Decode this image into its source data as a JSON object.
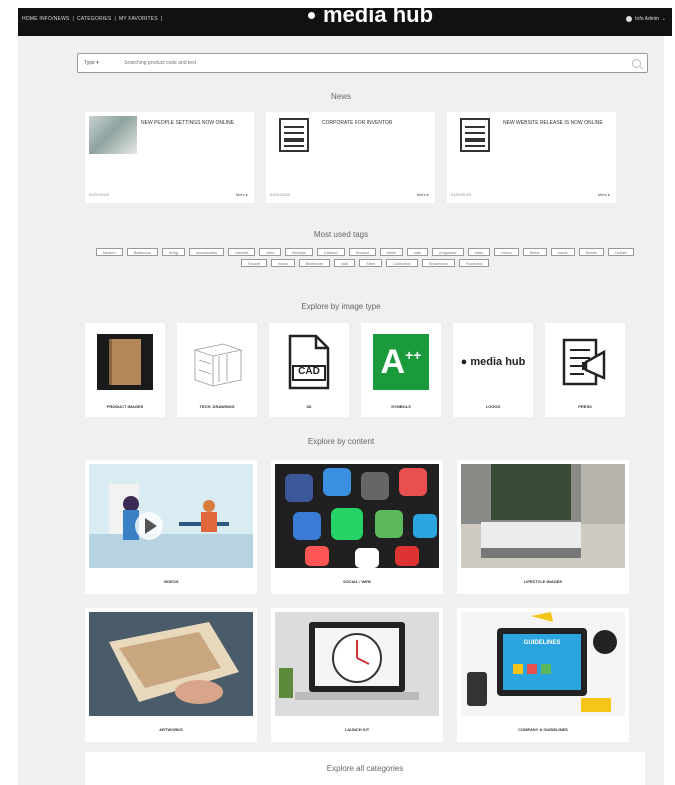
{
  "header": {
    "nav": [
      "HOME INFO/NEWS",
      "|",
      "CATEGORIES",
      "|",
      "MY FAVORITES",
      "|"
    ],
    "brand": "media hub",
    "user": "Info Admin"
  },
  "search": {
    "type_label": "Type ▾",
    "placeholder": "Searching product code and text"
  },
  "sections": {
    "news": "News",
    "tags": "Most used tags",
    "image_type": "Explore by image type",
    "content": "Explore by content",
    "all_categories": "Explore all categories"
  },
  "news": [
    {
      "title": "NEW PEOPLE SETTINGS NOW ONLINE",
      "date": "01/01/2023",
      "more": "Mehr ▸",
      "thumb": "photo"
    },
    {
      "title": "CORPORATE FOR INVENTOR",
      "date": "01/01/2023",
      "more": "Mehr ▸",
      "thumb": "doc"
    },
    {
      "title": "NEW WEBSITE RELEASE IS NOW ONLINE",
      "date": "01/01/2023",
      "more": "Mehr ▸",
      "thumb": "doc"
    }
  ],
  "tags": [
    "kitchen",
    "Bathroom",
    "living",
    "accessories",
    "cabinet",
    "wine",
    "lifestyle",
    "Cabinet",
    "Shower",
    "table",
    "sale",
    "magazine",
    "ritmo",
    "mirror",
    "Basic",
    "home",
    "Nordic",
    "Holder",
    "Faucet",
    "wood",
    "Bathroom",
    "wall",
    "Steel",
    "Collection",
    "Showroom",
    "Rounded"
  ],
  "image_types": [
    {
      "label": "PRODUCT IMAGES",
      "icon": "cabinet-product-icon"
    },
    {
      "label": "TECH. DRAWINGS",
      "icon": "technical-drawing-icon"
    },
    {
      "label": "3D",
      "icon": "cad-file-icon"
    },
    {
      "label": "SYMBOLS",
      "icon": "energy-label-icon"
    },
    {
      "label": "LOGOS",
      "icon": "media-hub-logo-icon"
    },
    {
      "label": "PRESS",
      "icon": "press-release-icon"
    }
  ],
  "type_texts": {
    "cad": "CAD",
    "energy": "A",
    "energy_sup": "++",
    "logo": "media hub"
  },
  "contents": [
    {
      "label": "VIDEOS"
    },
    {
      "label": "SOCIAL / WEB"
    },
    {
      "label": "LIFESTYLE IMAGES"
    },
    {
      "label": "ARTWORKS"
    },
    {
      "label": "LAUNCH KIT"
    },
    {
      "label": "COMPANY & GUIDELINES"
    }
  ],
  "guidelines_text": "GUIDELINES",
  "colors": {
    "header_bg": "#111111",
    "page_bg": "#f0f0f0",
    "energy_green": "#1a9a3a"
  }
}
